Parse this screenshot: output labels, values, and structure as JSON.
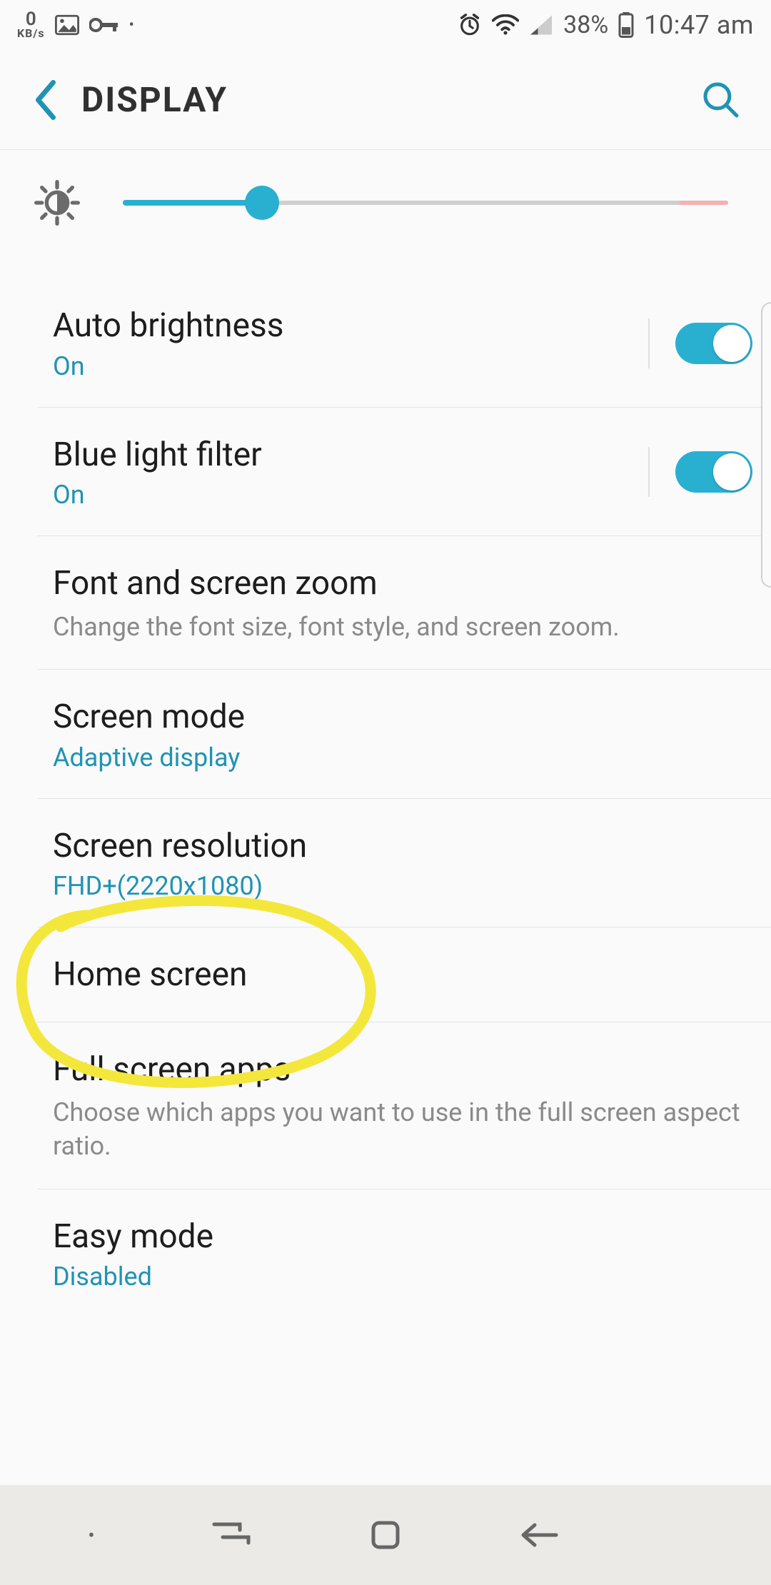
{
  "status_bar": {
    "data_rate_value": "0",
    "data_rate_unit": "KB/s",
    "battery_pct": "38%",
    "time": "10:47 am"
  },
  "app_bar": {
    "title": "DISPLAY"
  },
  "brightness": {
    "slider_pct": 23
  },
  "items": {
    "auto_brightness": {
      "title": "Auto brightness",
      "status": "On",
      "toggle": true
    },
    "blue_light": {
      "title": "Blue light filter",
      "status": "On",
      "toggle": true
    },
    "font_zoom": {
      "title": "Font and screen zoom",
      "desc": "Change the font size, font style, and screen zoom."
    },
    "screen_mode": {
      "title": "Screen mode",
      "status": "Adaptive display"
    },
    "resolution": {
      "title": "Screen resolution",
      "status": "FHD+(2220x1080)"
    },
    "home": {
      "title": "Home screen"
    },
    "fullscreen": {
      "title": "Full screen apps",
      "desc": "Choose which apps you want to use in the full screen aspect ratio."
    },
    "easy_mode": {
      "title": "Easy mode",
      "status": "Disabled"
    }
  },
  "colors": {
    "accent": "#29b0d1",
    "highlight": "#f4e73c"
  }
}
